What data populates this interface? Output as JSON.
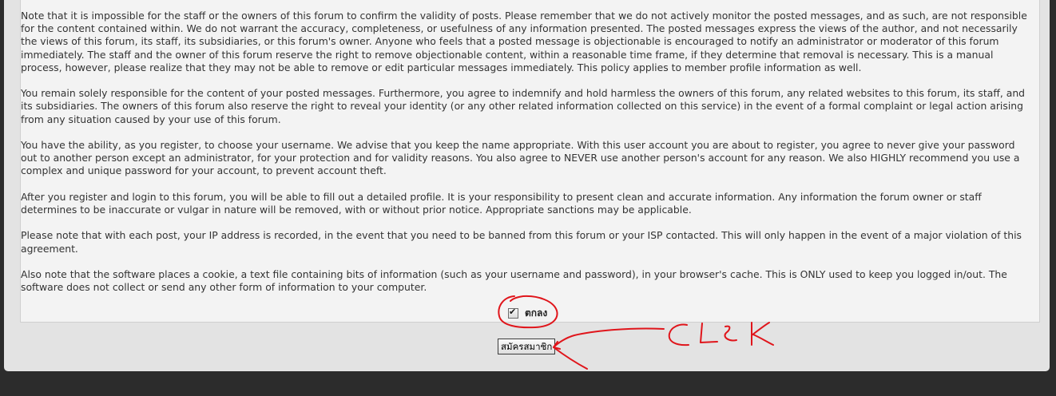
{
  "terms": {
    "paragraphs": [
      "Note that it is impossible for the staff or the owners of this forum to confirm the validity of posts. Please remember that we do not actively monitor the posted messages, and as such, are not responsible for the content contained within. We do not warrant the accuracy, completeness, or usefulness of any information presented. The posted messages express the views of the author, and not necessarily the views of this forum, its staff, its subsidiaries, or this forum's owner. Anyone who feels that a posted message is objectionable is encouraged to notify an administrator or moderator of this forum immediately. The staff and the owner of this forum reserve the right to remove objectionable content, within a reasonable time frame, if they determine that removal is necessary. This is a manual process, however, please realize that they may not be able to remove or edit particular messages immediately. This policy applies to member profile information as well.",
      "You remain solely responsible for the content of your posted messages. Furthermore, you agree to indemnify and hold harmless the owners of this forum, any related websites to this forum, its staff, and its subsidiaries. The owners of this forum also reserve the right to reveal your identity (or any other related information collected on this service) in the event of a formal complaint or legal action arising from any situation caused by your use of this forum.",
      "You have the ability, as you register, to choose your username. We advise that you keep the name appropriate. With this user account you are about to register, you agree to never give your password out to another person except an administrator, for your protection and for validity reasons. You also agree to NEVER use another person's account for any reason.  We also HIGHLY recommend you use a complex and unique password for your account, to prevent account theft.",
      "After you register and login to this forum, you will be able to fill out a detailed profile. It is your responsibility to present clean and accurate information. Any information the forum owner or staff determines to be inaccurate or vulgar in nature will be removed, with or without prior notice. Appropriate sanctions may be applicable.",
      "Please note that with each post, your IP address is recorded, in the event that you need to be banned from this forum or your ISP contacted. This will only happen in the event of a major violation of this agreement.",
      "Also note that the software places a cookie, a text file containing bits of information (such as your username and password), in your browser's cache. This is ONLY used to keep you logged in/out. The software does not collect or send any other form of information to your computer."
    ]
  },
  "agree": {
    "checked": true,
    "check_glyph": "✔",
    "label": "ตกลง"
  },
  "register": {
    "button_label": "สมัครสมาชิก"
  },
  "annotation": {
    "text": "CLICK",
    "color": "#e0151b"
  },
  "colors": {
    "page_background": "#2c2c2c",
    "panel_background": "#e3e3e3",
    "terms_background": "#f3f3f3",
    "text": "#333333"
  }
}
